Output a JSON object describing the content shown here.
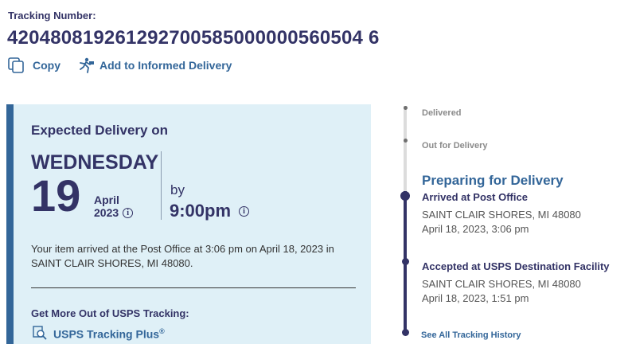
{
  "tracking": {
    "label": "Tracking Number:",
    "number": "420480819261292700585000000560504 6"
  },
  "actions": {
    "copy": "Copy",
    "informed": "Add to Informed Delivery"
  },
  "expected": {
    "title": "Expected Delivery on",
    "weekday": "WEDNESDAY",
    "day": "19",
    "month": "April",
    "year": "2023",
    "by": "by",
    "time": "9:00pm",
    "message": "Your item arrived at the Post Office at 3:06 pm on April 18, 2023 in SAINT CLAIR SHORES, MI 48080.",
    "more_title": "Get More Out of USPS Tracking:",
    "plus_label": "USPS Tracking Plus",
    "plus_mark": "®"
  },
  "timeline": {
    "delivered": "Delivered",
    "out_for_delivery": "Out for Delivery",
    "stage": "Preparing for Delivery",
    "events": [
      {
        "title": "Arrived at Post Office",
        "location": "SAINT CLAIR SHORES, MI 48080",
        "datetime": "April 18, 2023, 3:06 pm"
      },
      {
        "title": "Accepted at USPS Destination Facility",
        "location": "SAINT CLAIR SHORES, MI 48080",
        "datetime": "April 18, 2023, 1:51 pm"
      }
    ],
    "see_all": "See All Tracking History"
  },
  "colors": {
    "navy": "#333366",
    "link": "#336699",
    "card_bg": "#dff0f7"
  }
}
